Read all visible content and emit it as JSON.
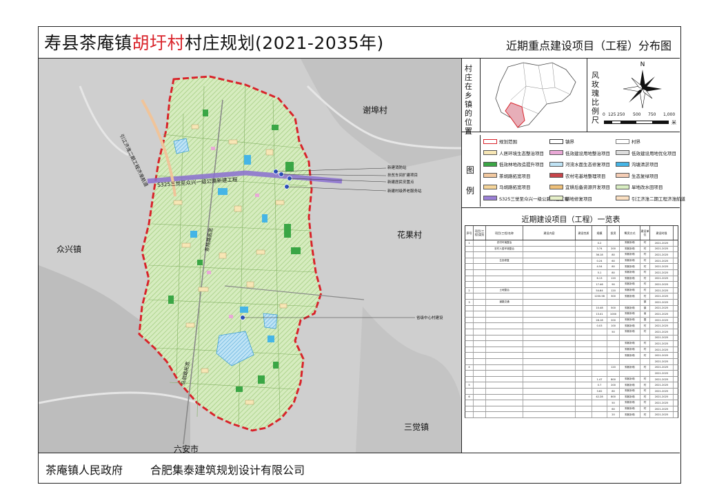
{
  "title": {
    "prefix": "寿县茶庵镇",
    "village": "胡圩村",
    "suffix": "村庄规划(2021-2035年)"
  },
  "subtitle": "近期重点建设项目（工程）分布图",
  "map": {
    "places": {
      "xiefu": "谢埠村",
      "zhongxing": "众兴镇",
      "huaguo": "花果村",
      "sanjue": "三觉镇",
      "liuan": "六安市"
    },
    "road_labels": {
      "s325": "S325三觉至众兴一级公路新建工程",
      "yinjiang": "引江济淮二期工程济淮航道",
      "chayang": "茶杨路拓宽",
      "mahu": "马胡路拓宽"
    },
    "annotations": {
      "a1": "新建消防站",
      "a2": "扶贫车间扩建项目",
      "a3": "新建居民安置点",
      "a4": "新建村级养老服务站",
      "a5": "省级中心村建设"
    }
  },
  "location_panel": {
    "label": "村庄在乡镇的位置",
    "compass_label": "风玫瑰比例尺",
    "scale_ticks": [
      "0",
      "125",
      "250",
      "500",
      "750",
      "1,000"
    ],
    "scale_unit": "米"
  },
  "legend": {
    "label": "图例",
    "items": [
      {
        "text": "规划范围",
        "color": "#ffffff",
        "border": "#d9232a"
      },
      {
        "text": "镇界",
        "color": "#ffffff",
        "border": "#333333"
      },
      {
        "text": "村界",
        "color": "#ffffff",
        "border": "#777777"
      },
      {
        "text": "人居环境生态整治项目",
        "color": "#f7e6b5",
        "border": "#555555"
      },
      {
        "text": "低效建设用地整治项目",
        "color": "#e9a8d6",
        "border": "#555555"
      },
      {
        "text": "低效建设用地优化项目",
        "color": "#dddddd",
        "border": "#555555"
      },
      {
        "text": "低效林地改造提升项目",
        "color": "#3aa645",
        "border": "#555555"
      },
      {
        "text": "河流水面生态修复项目",
        "color": "#bfe3f5",
        "border": "#555555"
      },
      {
        "text": "沟塘清淤项目",
        "color": "#45b5e6",
        "border": "#555555"
      },
      {
        "text": "茶胡路拓宽项目",
        "color": "#f2c9a0",
        "border": "#555555"
      },
      {
        "text": "农村宅基地整理项目",
        "color": "#c8454a",
        "border": "#555555"
      },
      {
        "text": "生态复绿项目",
        "color": "#f5cdb5",
        "border": "#555555"
      },
      {
        "text": "马胡路拓宽项目",
        "color": "#f5d59a",
        "border": "#555555"
      },
      {
        "text": "宜耕后备资源开发项目",
        "color": "#eec07a",
        "border": "#555555"
      },
      {
        "text": "旱地改水田项目",
        "color": "#d8edc1",
        "border": "#555555"
      },
      {
        "text": "S325三觉至众兴一级公路新建工程",
        "color": "#9b80d6",
        "border": "#555555"
      },
      {
        "text": "耕地修复项目",
        "color": "#e6f0c9",
        "border": "#555555"
      },
      {
        "text": "引江济淮二期工程济淮航道",
        "color": "#fbe0c2",
        "border": "#555555"
      }
    ]
  },
  "table": {
    "title": "近期建设项目（工程）一览表",
    "headers": [
      "序号",
      "项目(工程)类别",
      "项目(工程)名称",
      "建设内容",
      "建设性质",
      "规模",
      "投资",
      "筹资方式",
      "建设单位",
      "建设时限"
    ],
    "rows": [
      [
        "1",
        "",
        "农村环境整治",
        "",
        "",
        "0.2",
        "",
        "财政补助",
        "村",
        "2021-2025"
      ],
      [
        "",
        "",
        "农村人居环境整治",
        "",
        "",
        "3.74",
        "200",
        "财政补助",
        "村",
        "2021-2025"
      ],
      [
        "",
        "",
        "",
        "",
        "",
        "36.18",
        "80",
        "财政补助",
        "村",
        "2021-2025"
      ],
      [
        "",
        "",
        "生态修复",
        "",
        "",
        "0.24",
        "60",
        "财政补助",
        "村",
        "2021-2025"
      ],
      [
        "",
        "",
        "",
        "",
        "",
        "4.54",
        "80",
        "财政补助",
        "村",
        "2021-2025"
      ],
      [
        "",
        "",
        "",
        "",
        "",
        "5.1",
        "80",
        "财政补助",
        "村",
        "2021-2025"
      ],
      [
        "",
        "",
        "",
        "",
        "",
        "6.13",
        "120",
        "财政补助",
        "村",
        "2021-2025"
      ],
      [
        "",
        "",
        "",
        "",
        "",
        "17.46",
        "90",
        "财政补助",
        "村",
        "2021-2025"
      ],
      [
        "2",
        "",
        "土地整治",
        "",
        "",
        "54.64",
        "120",
        "财政补助",
        "村",
        "2021-2025"
      ],
      [
        "",
        "",
        "",
        "",
        "",
        "1200.58",
        "300",
        "财政补助",
        "村",
        "2021-2025"
      ],
      [
        "3",
        "",
        "道路交通",
        "",
        "",
        "",
        "",
        "",
        "镇",
        "2021-2025"
      ],
      [
        "",
        "",
        "",
        "",
        "",
        "10.48",
        "500",
        "财政补助",
        "镇",
        "2021-2025"
      ],
      [
        "",
        "",
        "",
        "",
        "",
        "13.41",
        "1000",
        "财政补助",
        "省",
        "2021-2025"
      ],
      [
        "",
        "",
        "",
        "",
        "",
        "28.18",
        "200",
        "财政补助",
        "国",
        "2021-2025"
      ],
      [
        "",
        "",
        "",
        "",
        "",
        "0.03",
        "100",
        "财政补助",
        "村",
        "2021-2025"
      ],
      [
        "",
        "",
        "",
        "",
        "",
        "",
        "50",
        "财政补助",
        "村",
        "2021-2025"
      ],
      [
        "",
        "",
        "",
        "",
        "",
        "",
        "",
        "",
        "",
        "2021-2025"
      ],
      [
        "",
        "",
        "",
        "",
        "",
        "",
        "",
        "财政补助",
        "村",
        "2021-2025"
      ],
      [
        "",
        "",
        "",
        "",
        "",
        "",
        "",
        "财政补助",
        "村",
        "2021-2025"
      ],
      [
        "",
        "",
        "",
        "",
        "",
        "",
        "",
        "财政补助",
        "村",
        "2021-2025"
      ],
      [
        "",
        "",
        "",
        "",
        "",
        "",
        "",
        "",
        "",
        "2021-2025"
      ],
      [
        "4",
        "",
        "",
        "",
        "",
        "",
        "120",
        "财政补助",
        "村",
        "2021-2025"
      ],
      [
        "",
        "",
        "",
        "",
        "",
        "",
        "",
        "",
        "",
        "2021-2025"
      ],
      [
        "",
        "",
        "",
        "",
        "",
        "1.47",
        "800",
        "财政补助",
        "村",
        "2021-2025"
      ],
      [
        "5",
        "",
        "",
        "",
        "",
        "0.7",
        "200",
        "财政补助",
        "村",
        "2021-2025"
      ],
      [
        "",
        "",
        "",
        "",
        "",
        "3.62",
        "80",
        "财政补助",
        "村",
        "2021-2025"
      ],
      [
        "6",
        "",
        "",
        "",
        "",
        "42.28",
        "800",
        "财政补助",
        "村",
        "2021-2025"
      ],
      [
        "",
        "",
        "",
        "",
        "",
        "",
        "50",
        "财政补助",
        "村",
        "2021-2025"
      ],
      [
        "",
        "",
        "",
        "",
        "",
        "",
        "60",
        "财政补助",
        "村",
        "2021-2025"
      ],
      [
        "",
        "",
        "",
        "",
        "",
        "",
        "20",
        "财政补助",
        "村",
        "2021-2025"
      ]
    ]
  },
  "footer": {
    "government": "茶庵镇人民政府",
    "institute": "合肥集泰建筑规划设计有限公司"
  }
}
